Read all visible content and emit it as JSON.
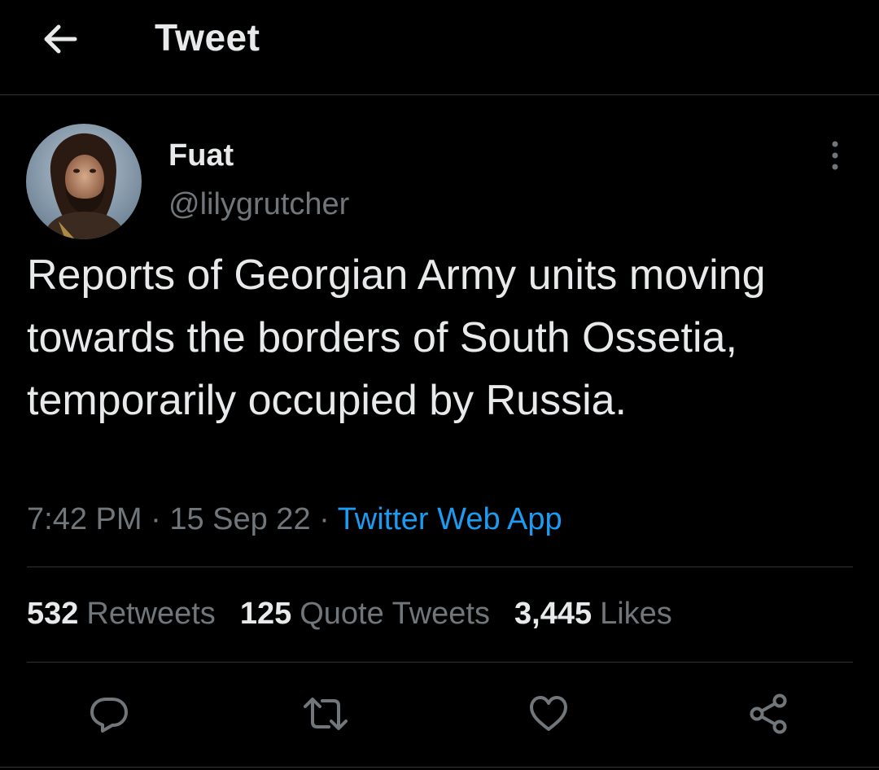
{
  "header": {
    "back_icon": "arrow-left-icon",
    "title": "Tweet"
  },
  "tweet": {
    "author": {
      "display_name": "Fuat",
      "handle": "@lilygrutcher",
      "avatar": "profile-photo"
    },
    "more_icon": "more-vertical-icon",
    "text": "Reports of Georgian Army units moving towards the borders of South Ossetia, temporarily occupied by Russia.",
    "time": "7:42 PM",
    "sep1": " · ",
    "date": "15 Sep 22",
    "sep2": " · ",
    "source": "Twitter Web App",
    "stats": {
      "retweets_count": "532",
      "retweets_label": "Retweets",
      "quotes_count": "125",
      "quotes_label": "Quote Tweets",
      "likes_count": "3,445",
      "likes_label": "Likes"
    },
    "actions": [
      {
        "name": "reply",
        "icon": "reply-icon"
      },
      {
        "name": "retweet",
        "icon": "retweet-icon"
      },
      {
        "name": "like",
        "icon": "heart-icon"
      },
      {
        "name": "share",
        "icon": "share-icon"
      }
    ]
  },
  "colors": {
    "background": "#000000",
    "text_primary": "#e7e9ea",
    "text_secondary": "#71767b",
    "accent": "#1d9bf0",
    "divider": "#2f3336"
  }
}
